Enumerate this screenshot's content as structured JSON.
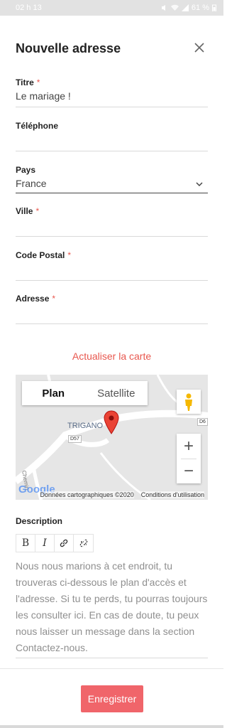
{
  "status_bar": {
    "time": "02 h 13",
    "battery": "61 %"
  },
  "modal": {
    "title": "Nouvelle adresse"
  },
  "fields": {
    "titre": {
      "label": "Titre",
      "required_mark": "*",
      "value": "Le mariage !"
    },
    "telephone": {
      "label": "Téléphone",
      "value": ""
    },
    "pays": {
      "label": "Pays",
      "value": "France"
    },
    "ville": {
      "label": "Ville",
      "required_mark": "*",
      "value": ""
    },
    "code_postal": {
      "label": "Code Postal",
      "required_mark": "*",
      "value": ""
    },
    "adresse": {
      "label": "Adresse",
      "required_mark": "*",
      "value": ""
    }
  },
  "map": {
    "refresh_label": "Actualiser la carte",
    "type_plan": "Plan",
    "type_satellite": "Satellite",
    "place_label": "TRIGANO",
    "road_label": "D57",
    "road_label_2": "D6",
    "street_label": "Chemin",
    "zoom_in": "+",
    "zoom_out": "−",
    "logo": "Google",
    "attribution": "Données cartographiques ©2020",
    "terms": "Conditions d'utilisation"
  },
  "description": {
    "label": "Description",
    "toolbar": {
      "bold": "B",
      "italic": "I"
    },
    "placeholder": "Nous nous marions à cet endroit, tu trouveras ci-dessous le plan d'accès et l'adresse. Si tu te perds, tu pourras toujours les consulter ici. En cas de doute, tu peux nous laisser un message dans la section Contactez-nous."
  },
  "actions": {
    "save_label": "Enregistrer"
  },
  "colors": {
    "accent": "#f0656a",
    "link": "#e8574e"
  }
}
